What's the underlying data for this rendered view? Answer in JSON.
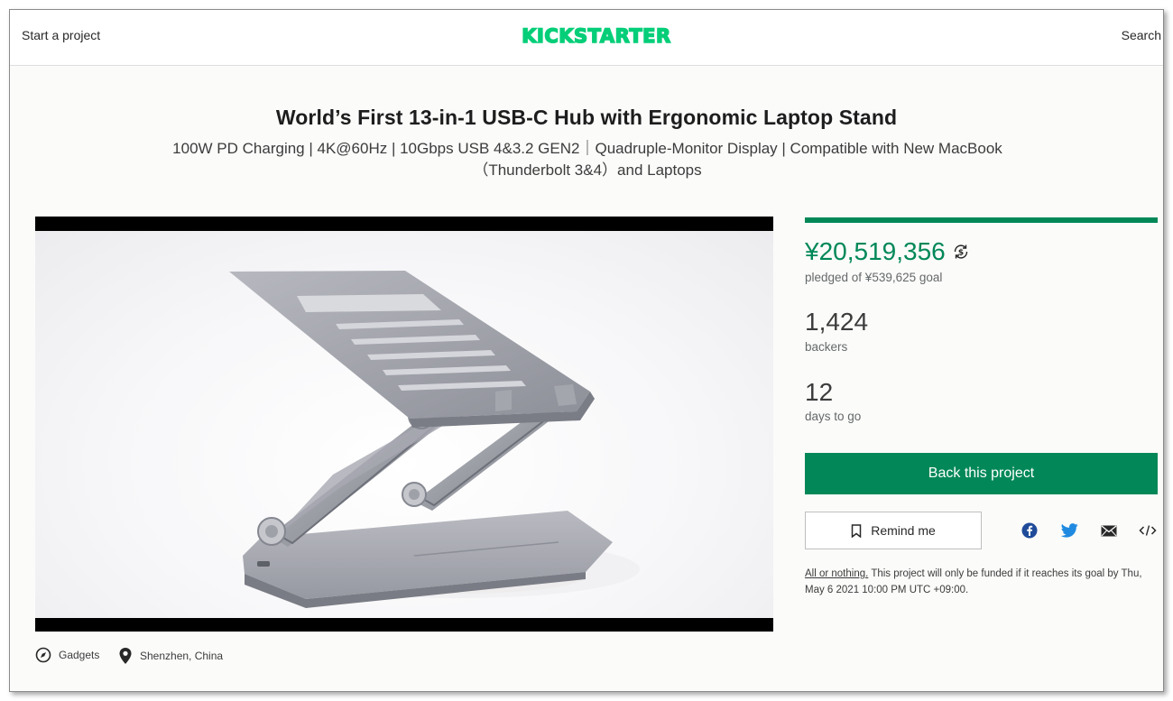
{
  "header": {
    "start_label": "Start a project",
    "logo_text": "KICKSTARTER",
    "search_label": "Search"
  },
  "project": {
    "title": "World’s First 13-in-1 USB-C Hub with Ergonomic Laptop Stand",
    "blurb": "100W PD Charging | 4K@60Hz | 10Gbps USB 4&3.2 GEN2｜Quadruple-Monitor Display | Compatible with New MacBook（Thunderbolt 3&4）and Laptops",
    "category": "Gadgets",
    "location": "Shenzhen, China"
  },
  "stats": {
    "pledged": "¥20,519,356",
    "pledged_goal": "pledged of ¥539,625 goal",
    "funded_fraction": 1.0,
    "backers_count": "1,424",
    "backers_label": "backers",
    "days_count": "12",
    "days_label": "days to go"
  },
  "actions": {
    "back_label": "Back this project",
    "remind_label": "Remind me",
    "share": [
      "facebook-icon",
      "twitter-icon",
      "mail-icon",
      "embed-icon"
    ]
  },
  "funding_note": {
    "link": "All or nothing.",
    "text": " This project will only be funded if it reaches its goal by Thu, May 6 2021 10:00 PM UTC +09:00."
  },
  "colors": {
    "accent": "#028858",
    "logo": "#05ce78"
  }
}
